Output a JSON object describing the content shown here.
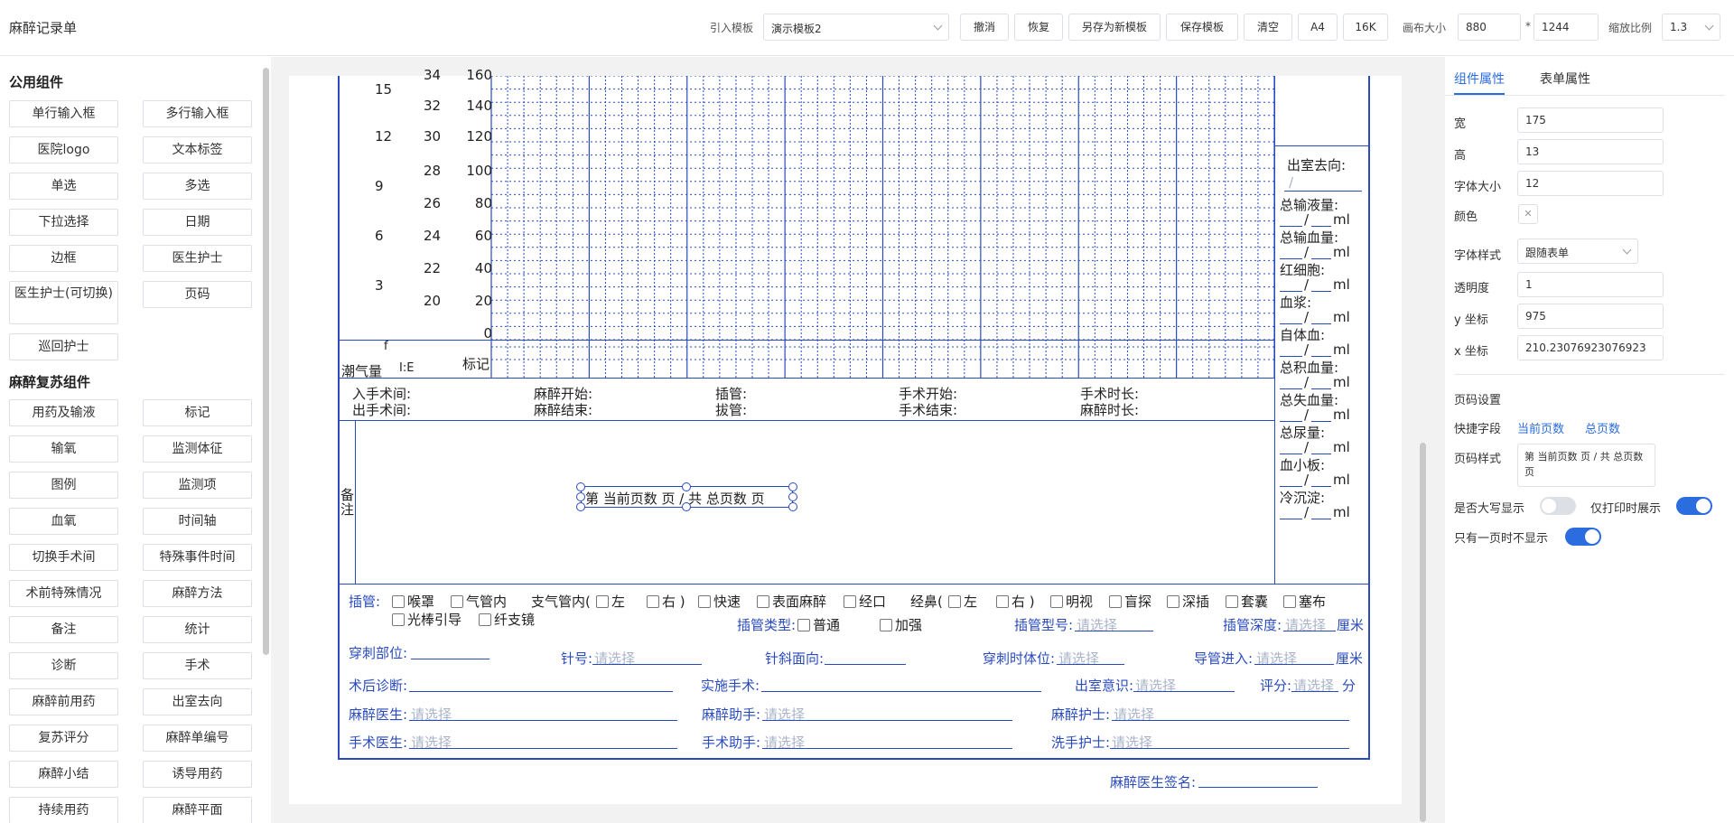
{
  "app": {
    "title": "麻醉记录单"
  },
  "toolbar": {
    "template_label": "引入模板",
    "template_value": "演示模板2",
    "buttons": [
      "撤消",
      "恢复",
      "另存为新模板",
      "保存模板",
      "清空",
      "A4",
      "16K"
    ],
    "canvas_size_label": "画布大小",
    "canvas_width": "880",
    "canvas_sep": "*",
    "canvas_height": "1244",
    "zoom_label": "缩放比例",
    "zoom_value": "1.3"
  },
  "left_panel": {
    "public_title": "公用组件",
    "public_items": [
      "单行输入框",
      "多行输入框",
      "医院logo",
      "文本标签",
      "单选",
      "多选",
      "下拉选择",
      "日期",
      "边框",
      "医生护士",
      "医生护士(可切换)",
      "页码",
      "巡回护士"
    ],
    "anes_title": "麻醉复苏组件",
    "anes_items": [
      "用药及输液",
      "标记",
      "输氧",
      "监测体征",
      "图例",
      "监测项",
      "血氧",
      "时间轴",
      "切换手术间",
      "特殊事件时间",
      "术前特殊情况",
      "麻醉方法",
      "备注",
      "统计",
      "诊断",
      "手术",
      "麻醉前用药",
      "出室去向",
      "复苏评分",
      "麻醉单编号",
      "麻醉小结",
      "诱导用药",
      "持续用药",
      "麻醉平面"
    ]
  },
  "form": {
    "axis_left": [
      "15",
      "12",
      "9",
      "6",
      "3"
    ],
    "axis_mid": [
      "34",
      "32",
      "30",
      "28",
      "26",
      "24",
      "22",
      "20"
    ],
    "axis_right": [
      "160",
      "140",
      "120",
      "100",
      "80",
      "60",
      "40",
      "20",
      "0"
    ],
    "tidal_f": "f",
    "tidal_label": "潮气量",
    "ie_label": "I:E",
    "mark_label": "标记",
    "stats": [
      "出室去向:",
      "总输液量:",
      "总输血量:",
      "红细胞:",
      "血浆:",
      "自体血:",
      "总积血量:",
      "总失血量:",
      "总尿量:",
      "血小板:",
      "冷沉淀:"
    ],
    "stat_slash": "/",
    "unit_ml": "ml",
    "times": {
      "row1": [
        "入手术间:",
        "麻醉开始:",
        "插管:",
        "手术开始:",
        "手术时长:"
      ],
      "row2": [
        "出手术间:",
        "麻醉结束:",
        "拔管:",
        "手术结束:",
        "麻醉时长:"
      ]
    },
    "remark_label": "备注",
    "page_text": "第 当前页数 页 / 共 总页数 页",
    "intubation": {
      "label": "插管:",
      "options_row1": [
        "喉罩",
        "气管内"
      ],
      "bronch_label": "支气管内(",
      "bronch_opts": [
        "左",
        "右 )"
      ],
      "options_row1b": [
        "快速",
        "表面麻醉",
        "经口"
      ],
      "nasal_label": "经鼻(",
      "nasal_opts": [
        "左",
        "右 )"
      ],
      "options_row1c": [
        "明视",
        "盲探",
        "深插",
        "套囊",
        "塞布"
      ],
      "options_row2": [
        "光棒引导",
        "纤支镜"
      ],
      "type_label": "插管类型:",
      "type_opts": [
        "普通",
        "加强"
      ],
      "model_label": "插管型号:",
      "depth_label": "插管深度:",
      "unit_cm": "厘米",
      "placeholder": "请选择"
    },
    "puncture": {
      "site": "穿刺部位:",
      "needle": "针号:",
      "bevel": "针斜面向:",
      "position": "穿刺时体位:",
      "catheter": "导管进入:",
      "unit_cm": "厘米"
    },
    "post": {
      "diagnosis": "术后诊断:",
      "surgery": "实施手术:",
      "consciousness": "出室意识:",
      "score": "评分:",
      "score_unit": "分"
    },
    "staff": {
      "anes_doctor": "麻醉医生:",
      "anes_assist": "麻醉助手:",
      "anes_nurse": "麻醉护士:",
      "surg_doctor": "手术医生:",
      "surg_assist": "手术助手:",
      "scrub_nurse": "洗手护士:"
    },
    "signature": "麻醉医生签名:"
  },
  "right_panel": {
    "tabs": [
      "组件属性",
      "表单属性"
    ],
    "props": [
      {
        "label": "宽",
        "value": "175"
      },
      {
        "label": "高",
        "value": "13"
      },
      {
        "label": "字体大小",
        "value": "12"
      }
    ],
    "color_label": "颜色",
    "font_style_label": "字体样式",
    "font_style_value": "跟随表单",
    "props2": [
      {
        "label": "透明度",
        "value": "1"
      },
      {
        "label": "y 坐标",
        "value": "975"
      },
      {
        "label": "x 坐标",
        "value": "210.23076923076923"
      }
    ],
    "page_settings": "页码设置",
    "quick_label": "快捷字段",
    "quick_links": [
      "当前页数",
      "总页数"
    ],
    "style_label": "页码样式",
    "style_value": "第 当前页数 页 / 共 总页数 页",
    "uppercase_label": "是否大写显示",
    "uppercase_on": false,
    "print_only_label": "仅打印时展示",
    "print_only_on": true,
    "single_page_label": "只有一页时不显示",
    "single_page_on": true
  },
  "colors": {
    "accent": "#2a4bbd",
    "toggle_on": "#2b6cdf"
  }
}
